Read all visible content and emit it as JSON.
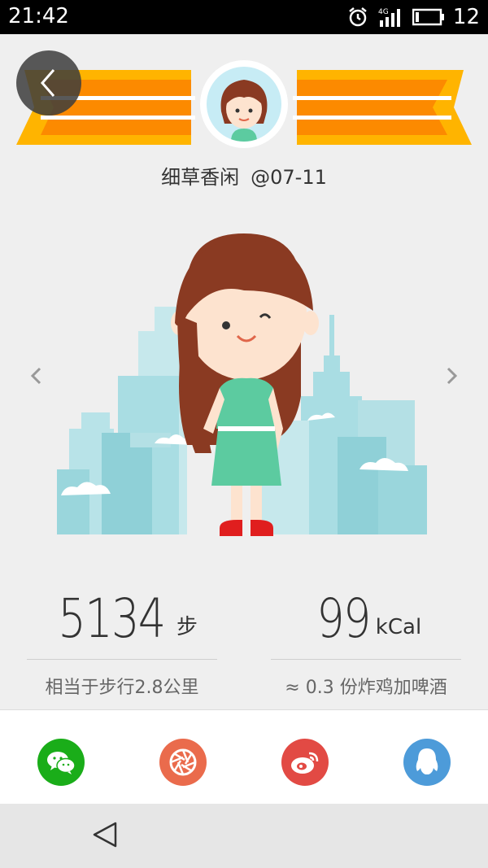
{
  "status_bar": {
    "time": "21:42",
    "network": "4G",
    "battery_level": "12",
    "icons": [
      "alarm-icon",
      "signal-icon",
      "battery-icon"
    ]
  },
  "profile": {
    "name": "细草香闲",
    "date": "@07-11"
  },
  "stats": {
    "steps": {
      "value": "5134",
      "unit": "步",
      "description": "相当于步行2.8公里"
    },
    "calories": {
      "value": "99",
      "unit": "kCal",
      "description": "≈ 0.3 份炸鸡加啤酒"
    }
  },
  "share": {
    "items": [
      {
        "name": "wechat",
        "icon": "wechat-icon",
        "color": "#1aad19"
      },
      {
        "name": "moments",
        "icon": "camera-aperture-icon",
        "color": "#ea6b4c"
      },
      {
        "name": "weibo",
        "icon": "weibo-icon",
        "color": "#e24a44"
      },
      {
        "name": "qq",
        "icon": "qq-penguin-icon",
        "color": "#4d9bd9"
      }
    ]
  },
  "colors": {
    "banner_orange": "#fc8a00",
    "banner_yellow": "#ffb400",
    "city_blue": "#9fd8de",
    "hair_brown": "#8a3a22",
    "dress_green": "#5ccba0"
  }
}
